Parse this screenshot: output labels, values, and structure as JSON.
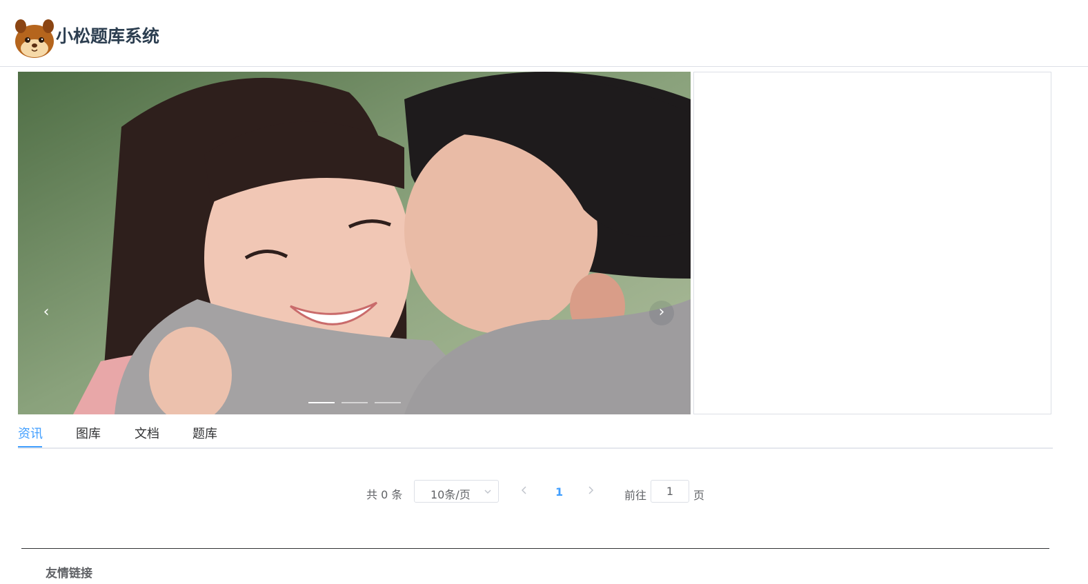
{
  "header": {
    "site_title": "小松题库系统",
    "logo_icon": "squirrel-logo-icon"
  },
  "carousel": {
    "prev_arrow": "‹",
    "next_arrow": "›",
    "slide_count": 3,
    "active_slide": 1
  },
  "tabs": [
    {
      "label": "资讯",
      "active": true
    },
    {
      "label": "图库",
      "active": false
    },
    {
      "label": "文档",
      "active": false
    },
    {
      "label": "题库",
      "active": false
    }
  ],
  "pagination": {
    "total_text": "共 0 条",
    "page_size": "10条/页",
    "current_page": "1",
    "goto_label": "前往",
    "goto_value": "1",
    "page_suffix": "页"
  },
  "footer": {
    "title": "友情链接"
  },
  "colors": {
    "accent": "#409eff",
    "border": "#dcdfe6",
    "text": "#303133"
  }
}
